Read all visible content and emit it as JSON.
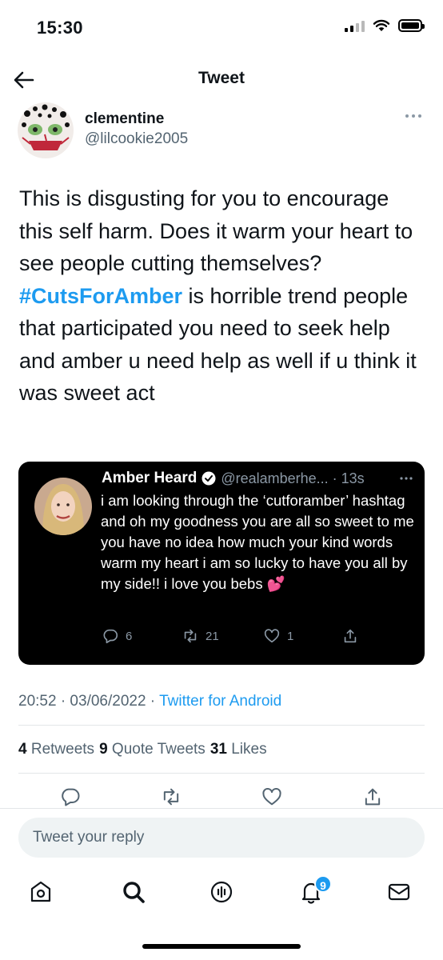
{
  "status_bar": {
    "time": "15:30"
  },
  "header": {
    "title": "Tweet"
  },
  "tweet": {
    "author_name": "clementine",
    "author_handle": "@lilcookie2005",
    "text_before": "This is disgusting for you to encourage this self harm. Does it warm your heart to see people cutting themselves?",
    "hashtag": "#CutsForAmber",
    "text_after": " is horrible trend people that participated you need to seek help and amber u need help as well if u think it was sweet act"
  },
  "quoted_tweet": {
    "author_name": "Amber Heard",
    "author_handle": "@realamberhe... · 13s",
    "text": "i am looking through the ‘cutforamber’ hashtag and oh my goodness you are all so sweet to me you have no idea how much your kind words warm my heart i am so lucky to have you all by my side!! i love you bebs 💕",
    "replies": "6",
    "retweets": "21",
    "likes": "1"
  },
  "meta": {
    "time_date": "20:52 · 03/06/2022 · ",
    "source": "Twitter for Android"
  },
  "stats": {
    "retweets_count": "4",
    "retweets_label": "Retweets",
    "quotes_count": "9",
    "quotes_label": "Quote Tweets",
    "likes_count": "31",
    "likes_label": "Likes"
  },
  "reply": {
    "placeholder": "Tweet your reply"
  },
  "tab_bar": {
    "notification_badge": "9"
  },
  "colors": {
    "accent": "#1d9bf0",
    "secondary_text": "#536471",
    "quote_bg": "#000000"
  },
  "icons": [
    "back-arrow-icon",
    "more-icon",
    "verified-icon",
    "reply-icon",
    "retweet-icon",
    "like-icon",
    "share-icon",
    "home-icon",
    "search-icon",
    "spaces-icon",
    "notifications-icon",
    "messages-icon"
  ]
}
